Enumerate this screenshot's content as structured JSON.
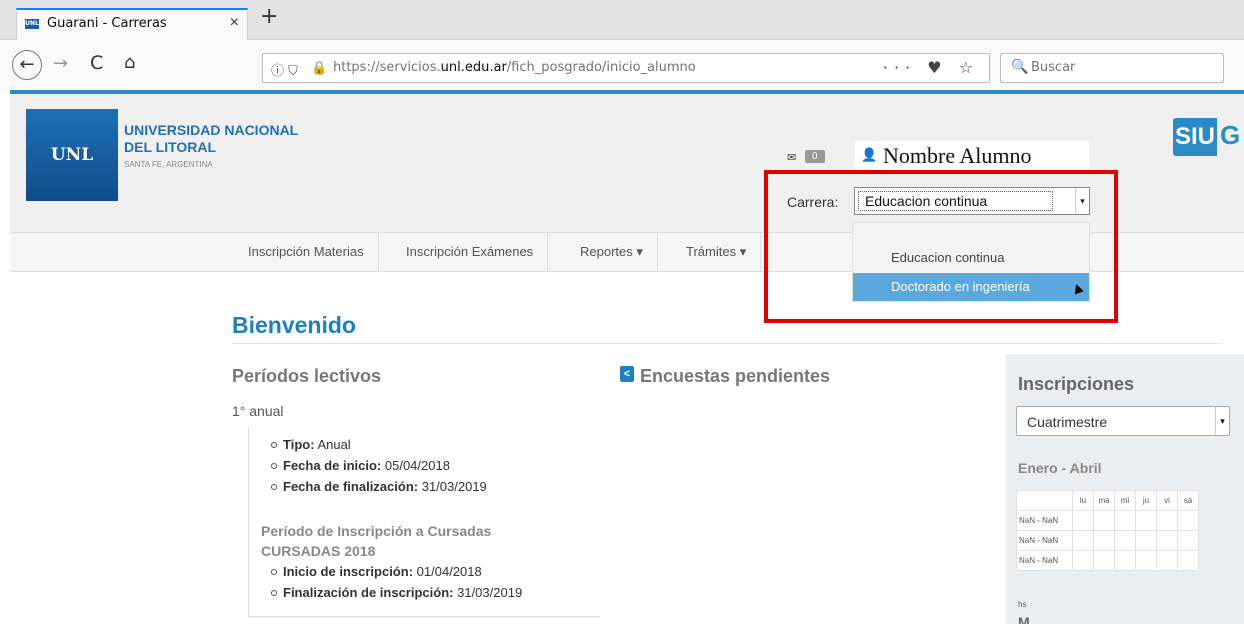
{
  "browser": {
    "tab_title": "Guarani - Carreras",
    "tab_favicon": "UNL",
    "tab_close": "×",
    "new_tab": "+",
    "url_prefix": "https://servicios.",
    "url_domain": "unl.edu.ar",
    "url_path": "/fich_posgrado/inicio_alumno",
    "url_info_icons": "ⓘ ⛉",
    "url_actions": "··· ♥ ☆",
    "search_placeholder": "Buscar",
    "search_icon": "🔍",
    "back_icon": "←",
    "forward_icon": "→",
    "reload_icon": "C",
    "home_icon": "⌂",
    "lock_icon": "🔒"
  },
  "header": {
    "logo_text": "UNL",
    "uni_name_line1": "UNIVERSIDAD NACIONAL",
    "uni_name_line2": "DEL LITORAL",
    "uni_location": "SANTA FE, ARGENTINA",
    "mail_icon": "✉",
    "mail_count": "0",
    "user_icon": "👤",
    "user_name": "Nombre Alumno",
    "carrera_label": "Carrera:",
    "carrera_selected": "Educacion continua",
    "dropdown_arrow": "▾",
    "siu_logo": "SIU",
    "siu_extra": "G",
    "siu_extra_small": "S"
  },
  "dropdown": {
    "options": [
      "Educacion continua",
      "Doctorado en ingeniería"
    ],
    "highlighted_index": 1
  },
  "menu": {
    "items": [
      {
        "label": "Inscripción Materias"
      },
      {
        "label": "Inscripción Exámenes"
      },
      {
        "label": "Reportes ▾"
      },
      {
        "label": "Trámites ▾"
      }
    ]
  },
  "main": {
    "welcome": "Bienvenido",
    "periodos_title": "Períodos lectivos",
    "periodo_name": "1° anual",
    "tipo_label": "Tipo:",
    "tipo_value": "Anual",
    "inicio_label": "Fecha de inicio:",
    "inicio_value": "05/04/2018",
    "fin_label": "Fecha de finalización:",
    "fin_value": "31/03/2019",
    "insc_title_line1": "Período de Inscripción a Cursadas",
    "insc_title_line2": "CURSADAS 2018",
    "insc_inicio_label": "Inicio de inscripción:",
    "insc_inicio_value": "01/04/2018",
    "insc_fin_label": "Finalización de inscripción:",
    "insc_fin_value": "31/03/2019",
    "encuestas_icon": "<",
    "encuestas_title": "Encuestas pendientes"
  },
  "side": {
    "title": "Inscripciones",
    "select_value": "Cuatrimestre",
    "select_arrow": "▾",
    "period": "Enero - Abril",
    "days": [
      "lu",
      "ma",
      "mi",
      "ju",
      "vi",
      "sá"
    ],
    "rows": [
      "NaN - NaN",
      "NaN - NaN",
      "NaN - NaN"
    ],
    "hs": "hs",
    "cut_text": "M"
  },
  "colors": {
    "accent": "#2a8bc7",
    "brand_blue": "#1e70b8",
    "highlight": "#5aa8dd",
    "annotation_red": "#e00000"
  }
}
